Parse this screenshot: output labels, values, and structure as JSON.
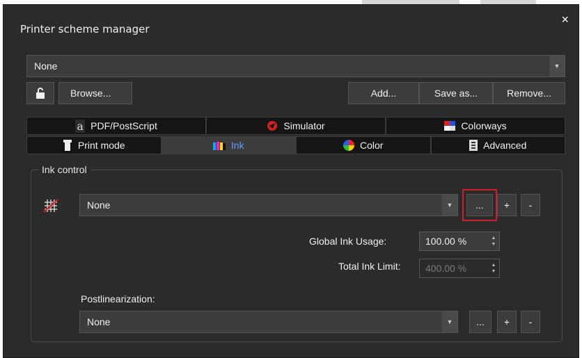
{
  "window": {
    "title": "Printer scheme manager",
    "close_symbol": "×"
  },
  "scheme": {
    "selected": "None",
    "toolbar": {
      "browse": "Browse...",
      "add": "Add...",
      "save_as": "Save as...",
      "remove": "Remove..."
    }
  },
  "tabs_top": [
    {
      "label": "PDF/PostScript",
      "icon": "adobe-icon"
    },
    {
      "label": "Simulator",
      "icon": "simulator-icon"
    },
    {
      "label": "Colorways",
      "icon": "colorways-icon"
    }
  ],
  "tabs_bottom": [
    {
      "label": "Print mode",
      "icon": "print-mode-icon"
    },
    {
      "label": "Ink",
      "icon": "ink-icon",
      "active": true
    },
    {
      "label": "Color",
      "icon": "color-wheel-icon"
    },
    {
      "label": "Advanced",
      "icon": "advanced-icon"
    }
  ],
  "ink_control": {
    "legend": "Ink control",
    "ink_selection": "None",
    "more_button": "...",
    "add_button": "+",
    "remove_button": "-",
    "global_ink_usage_label": "Global Ink Usage:",
    "global_ink_usage_value": "100.00 %",
    "total_ink_limit_label": "Total Ink Limit:",
    "total_ink_limit_value": "400.00 %",
    "postlinearization_label": "Postlinearization:",
    "postlinearization_value": "None"
  },
  "colors": {
    "active_tab_text": "#5f9fff",
    "highlight_border": "#d0202a"
  }
}
